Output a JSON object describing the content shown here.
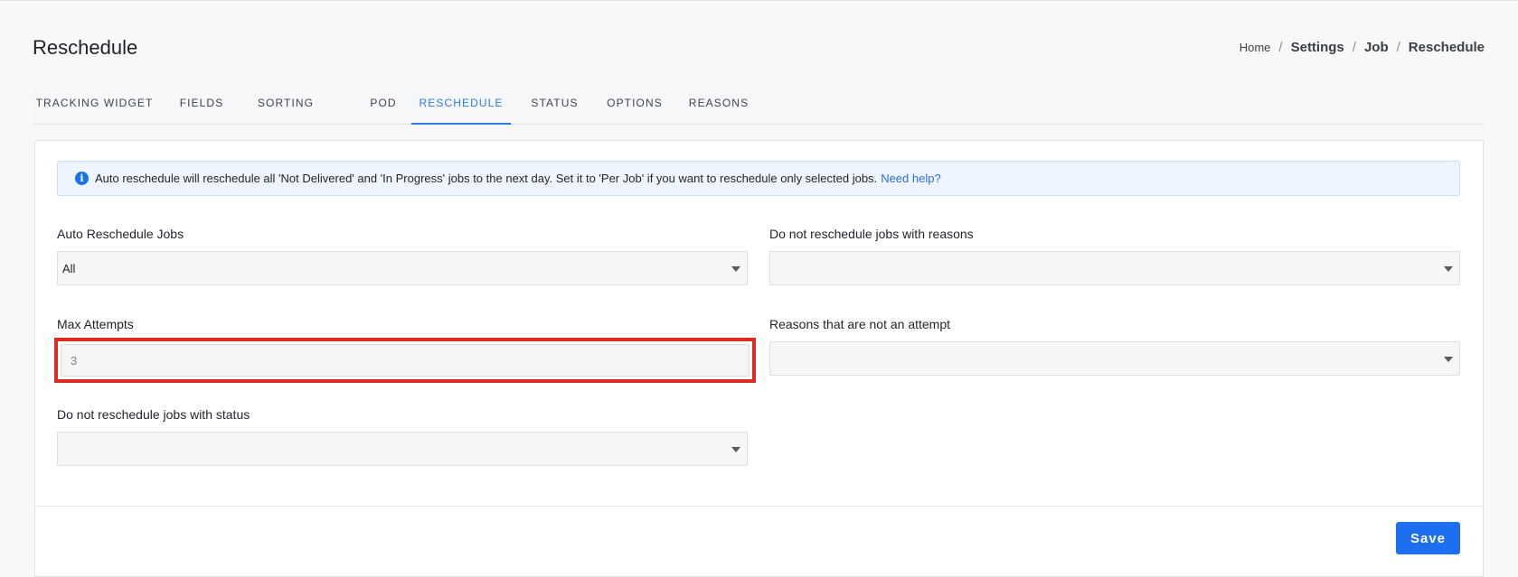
{
  "header": {
    "title": "Reschedule",
    "breadcrumb": [
      "Home",
      "Settings",
      "Job",
      "Reschedule"
    ]
  },
  "tabs": [
    {
      "label": "TRACKING WIDGET",
      "active": false
    },
    {
      "label": "FIELDS",
      "active": false
    },
    {
      "label": "SORTING",
      "active": false
    },
    {
      "label": "POD",
      "active": false
    },
    {
      "label": "RESCHEDULE",
      "active": true
    },
    {
      "label": "STATUS",
      "active": false
    },
    {
      "label": "OPTIONS",
      "active": false
    },
    {
      "label": "REASONS",
      "active": false
    }
  ],
  "alert": {
    "icon": "info-icon",
    "text": "Auto reschedule will reschedule all 'Not Delivered' and 'In Progress' jobs to the next day. Set it to 'Per Job' if you want to reschedule only selected jobs.",
    "link": "Need help?"
  },
  "form": {
    "auto_reschedule": {
      "label": "Auto Reschedule Jobs",
      "value": "All"
    },
    "exclude_reasons": {
      "label": "Do not reschedule jobs with reasons",
      "value": ""
    },
    "max_attempts": {
      "label": "Max Attempts",
      "value": "3"
    },
    "not_attempt_reasons": {
      "label": "Reasons that are not an attempt",
      "value": ""
    },
    "exclude_status": {
      "label": "Do not reschedule jobs with status",
      "value": ""
    }
  },
  "actions": {
    "save_label": "Save"
  },
  "colors": {
    "accent": "#1e6ff0",
    "highlight": "#e02b22",
    "info_bg": "#eef5fe"
  }
}
